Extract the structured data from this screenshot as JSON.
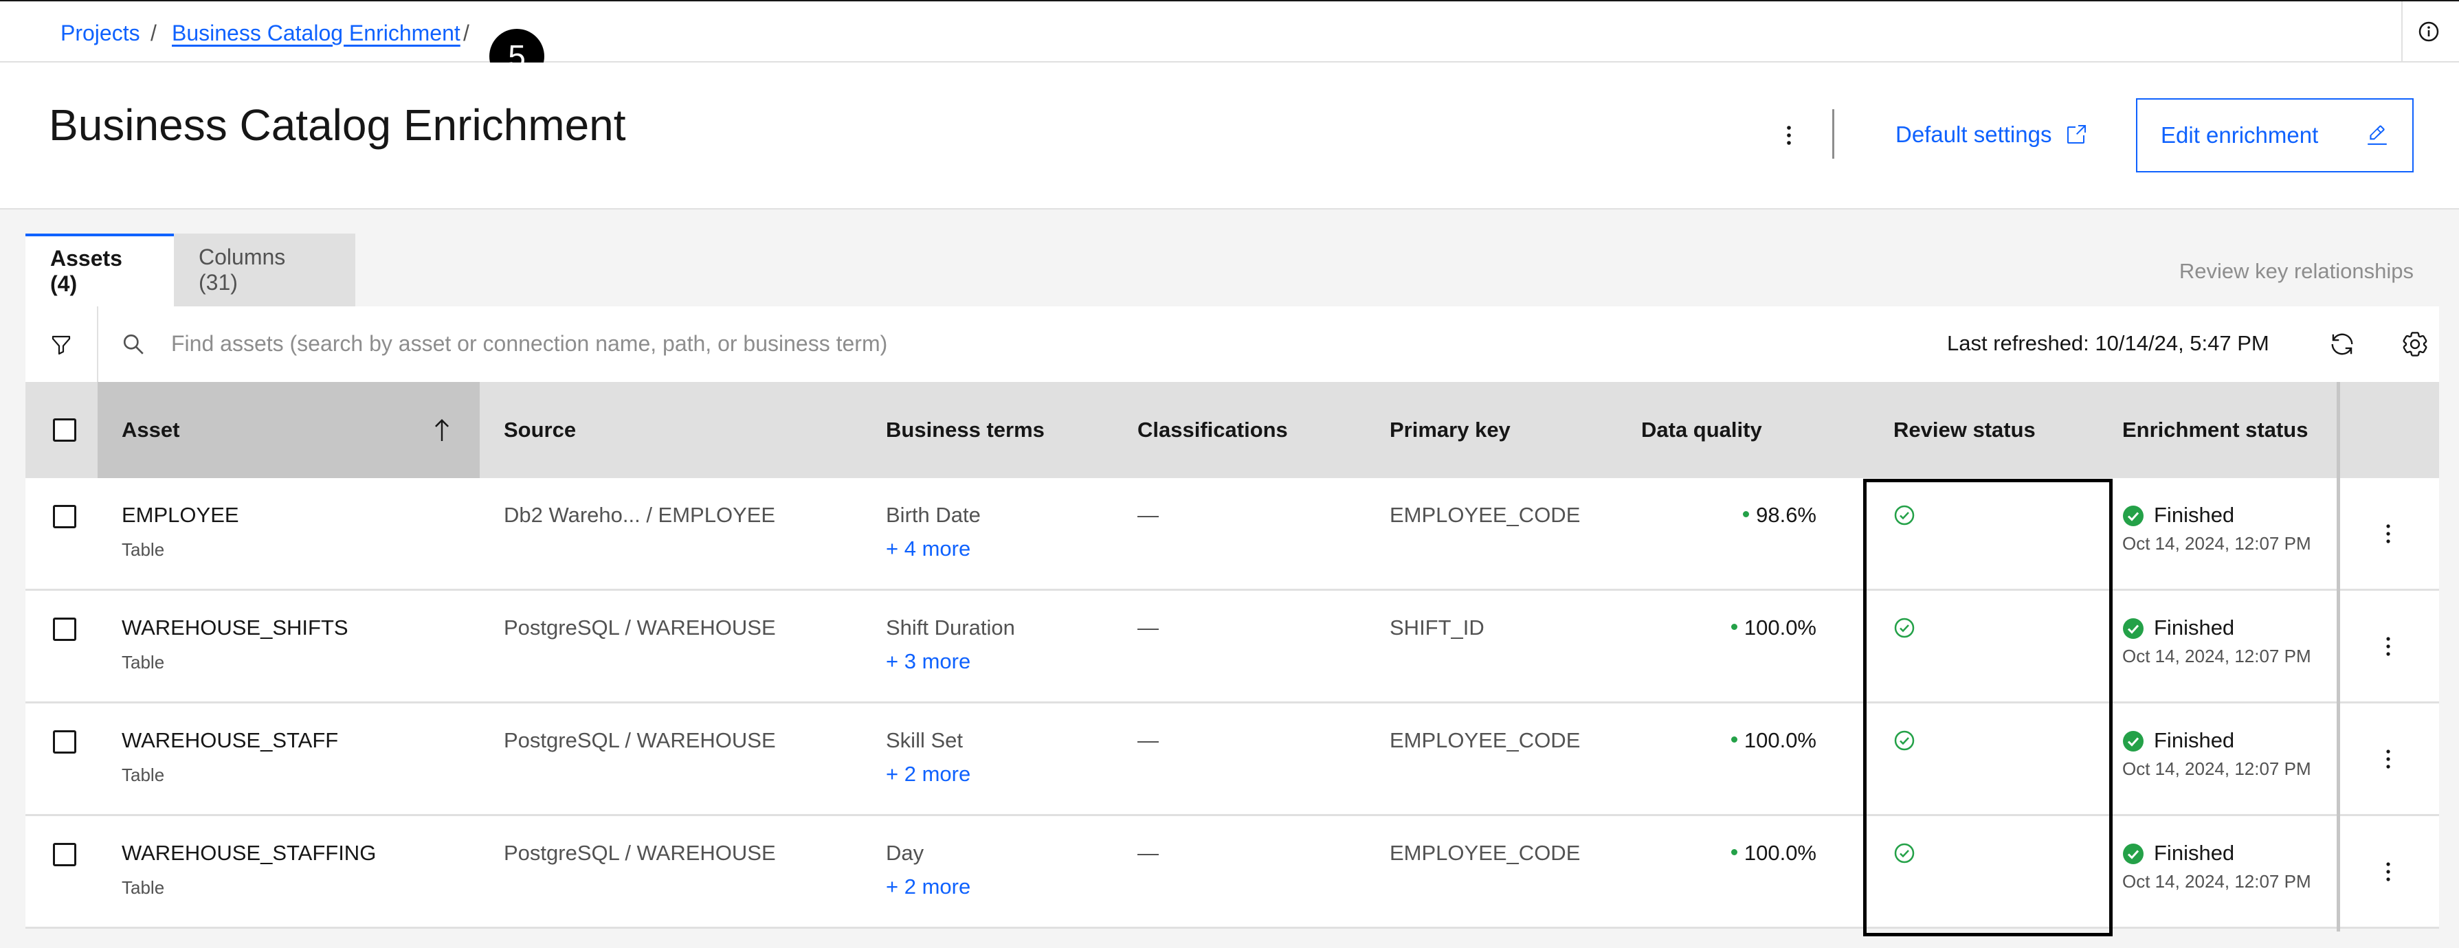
{
  "breadcrumb": {
    "projects": "Projects",
    "separator": "/",
    "current": "Business Catalog Enrichment",
    "trailing_separator": "/"
  },
  "step_badge": "5",
  "header": {
    "title": "Business Catalog Enrichment",
    "default_settings": "Default settings",
    "edit_enrichment": "Edit enrichment"
  },
  "tabs": [
    {
      "label": "Assets (4)",
      "active": true
    },
    {
      "label": "Columns (31)",
      "active": false
    }
  ],
  "review_key_relationships": "Review key relationships",
  "toolbar": {
    "search_placeholder": "Find assets (search by asset or connection name, path, or business term)",
    "last_refreshed": "Last refreshed: 10/14/24, 5:47 PM"
  },
  "table": {
    "columns": [
      "Asset",
      "Source",
      "Business terms",
      "Classifications",
      "Primary key",
      "Data quality",
      "Review status",
      "Enrichment status"
    ],
    "rows": [
      {
        "asset": "EMPLOYEE",
        "type": "Table",
        "source": "Db2 Wareho...   /  EMPLOYEE",
        "term": "Birth Date",
        "more": "+ 4 more",
        "classification": "—",
        "primary_key": "EMPLOYEE_CODE",
        "data_quality": "98.6%",
        "enrichment": "Finished",
        "enrichment_date": "Oct 14, 2024, 12:07 PM"
      },
      {
        "asset": "WAREHOUSE_SHIFTS",
        "type": "Table",
        "source": "PostgreSQL  /  WAREHOUSE",
        "term": "Shift Duration",
        "more": "+ 3 more",
        "classification": "—",
        "primary_key": "SHIFT_ID",
        "data_quality": "100.0%",
        "enrichment": "Finished",
        "enrichment_date": "Oct 14, 2024, 12:07 PM"
      },
      {
        "asset": "WAREHOUSE_STAFF",
        "type": "Table",
        "source": "PostgreSQL  /  WAREHOUSE",
        "term": "Skill Set",
        "more": "+ 2 more",
        "classification": "—",
        "primary_key": "EMPLOYEE_CODE",
        "data_quality": "100.0%",
        "enrichment": "Finished",
        "enrichment_date": "Oct 14, 2024, 12:07 PM"
      },
      {
        "asset": "WAREHOUSE_STAFFING",
        "type": "Table",
        "source": "PostgreSQL  /  WAREHOUSE",
        "term": "Day",
        "more": "+ 2 more",
        "classification": "—",
        "primary_key": "EMPLOYEE_CODE",
        "data_quality": "100.0%",
        "enrichment": "Finished",
        "enrichment_date": "Oct 14, 2024, 12:07 PM"
      }
    ]
  },
  "icons": {
    "info": "info-icon",
    "overflow": "overflow-menu-icon",
    "launch": "launch-icon",
    "edit": "edit-icon",
    "filter": "filter-icon",
    "search": "search-icon",
    "refresh": "refresh-icon",
    "settings": "settings-icon",
    "sort": "arrow-up-icon",
    "review_ok": "checkmark-outline-icon",
    "finished": "checkmark-filled-icon"
  },
  "colors": {
    "link": "#0f62fe",
    "success": "#24a148",
    "header_bg": "#e0e0e0",
    "page_bg": "#f4f4f4"
  }
}
